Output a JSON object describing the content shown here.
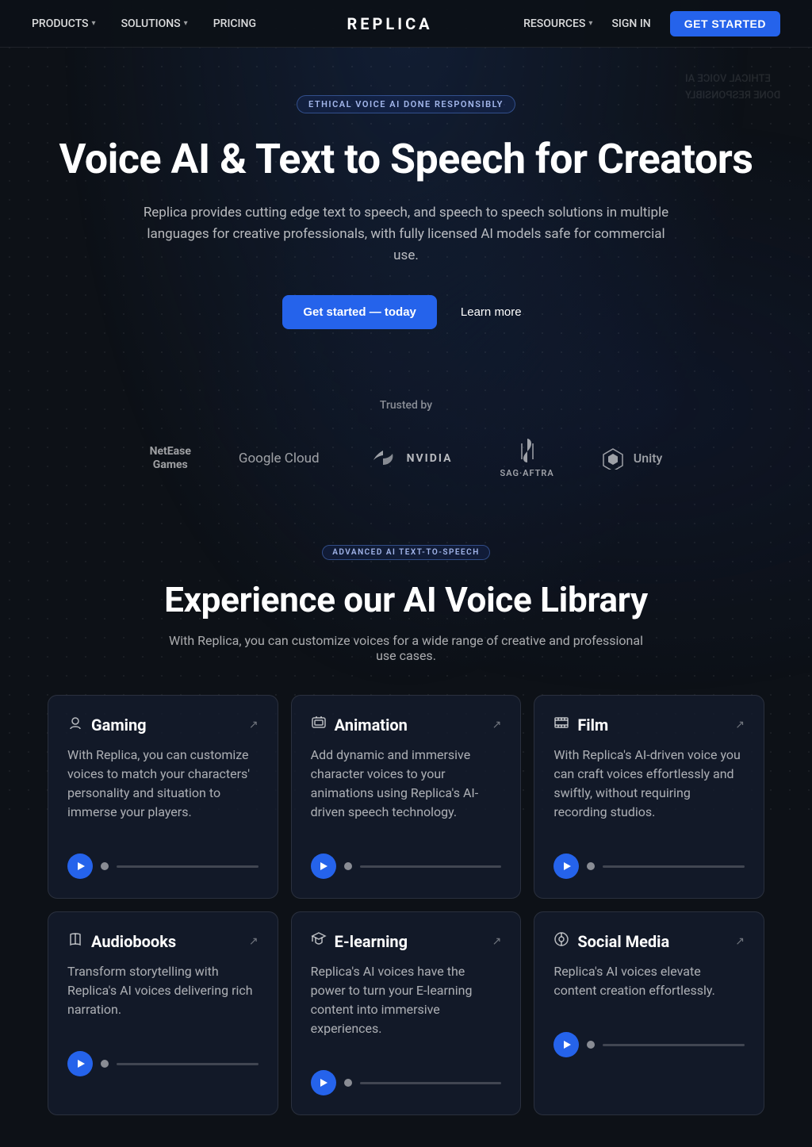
{
  "nav": {
    "logo": "REPLICA",
    "left_items": [
      {
        "label": "PRODUCTS",
        "has_chevron": true
      },
      {
        "label": "SOLUTIONS",
        "has_chevron": true
      },
      {
        "label": "PRICING",
        "has_chevron": false
      }
    ],
    "right_items": [
      {
        "label": "RESOURCES",
        "has_chevron": true
      },
      {
        "label": "SIGN IN",
        "has_chevron": false
      }
    ],
    "cta_label": "GET STARTED"
  },
  "hero": {
    "badge": "ETHICAL VOICE AI DONE RESPONSIBLY",
    "bg_text_line1": "ETHICAL VOICE AI",
    "bg_text_line2": "DONE RESPONSIBLY",
    "title": "Voice AI & Text to Speech for Creators",
    "description": "Replica provides cutting edge text to speech, and speech to speech solutions in multiple languages for creative professionals, with fully licensed AI models safe for commercial use.",
    "cta_primary": "Get started — today",
    "cta_secondary": "Learn more"
  },
  "trusted": {
    "label": "Trusted by",
    "logos": [
      {
        "name": "NetEase Games",
        "class": "logo-netease"
      },
      {
        "name": "Google Cloud",
        "class": "logo-google"
      },
      {
        "name": "NVIDIA",
        "class": "logo-nvidia"
      },
      {
        "name": "SAG·AFTRA",
        "class": "logo-sag"
      },
      {
        "name": "Unity",
        "class": "logo-unity"
      }
    ]
  },
  "voice_library": {
    "badge": "ADVANCED AI TEXT-TO-SPEECH",
    "title": "Experience our AI Voice Library",
    "description": "With Replica, you can customize voices for a wide range of creative and professional use cases.",
    "cards": [
      {
        "id": "gaming",
        "icon": "👤",
        "title": "Gaming",
        "description": "With Replica, you can customize voices to match your characters' personality and situation to immerse your players."
      },
      {
        "id": "animation",
        "icon": "◈",
        "title": "Animation",
        "description": "Add dynamic and immersive character voices to your animations using Replica's AI-driven speech technology."
      },
      {
        "id": "film",
        "icon": "▦",
        "title": "Film",
        "description": "With Replica's AI-driven voice you can craft voices effortlessly and swiftly, without requiring recording studios."
      },
      {
        "id": "audiobooks",
        "icon": "📖",
        "title": "Audiobooks",
        "description": "Transform storytelling with Replica's AI voices delivering rich narration."
      },
      {
        "id": "elearning",
        "icon": "🎓",
        "title": "E-learning",
        "description": "Replica's AI voices have the power to turn your E-learning content into immersive experiences."
      },
      {
        "id": "social-media",
        "icon": "📻",
        "title": "Social Media",
        "description": "Replica's AI voices elevate content creation effortlessly."
      }
    ]
  }
}
